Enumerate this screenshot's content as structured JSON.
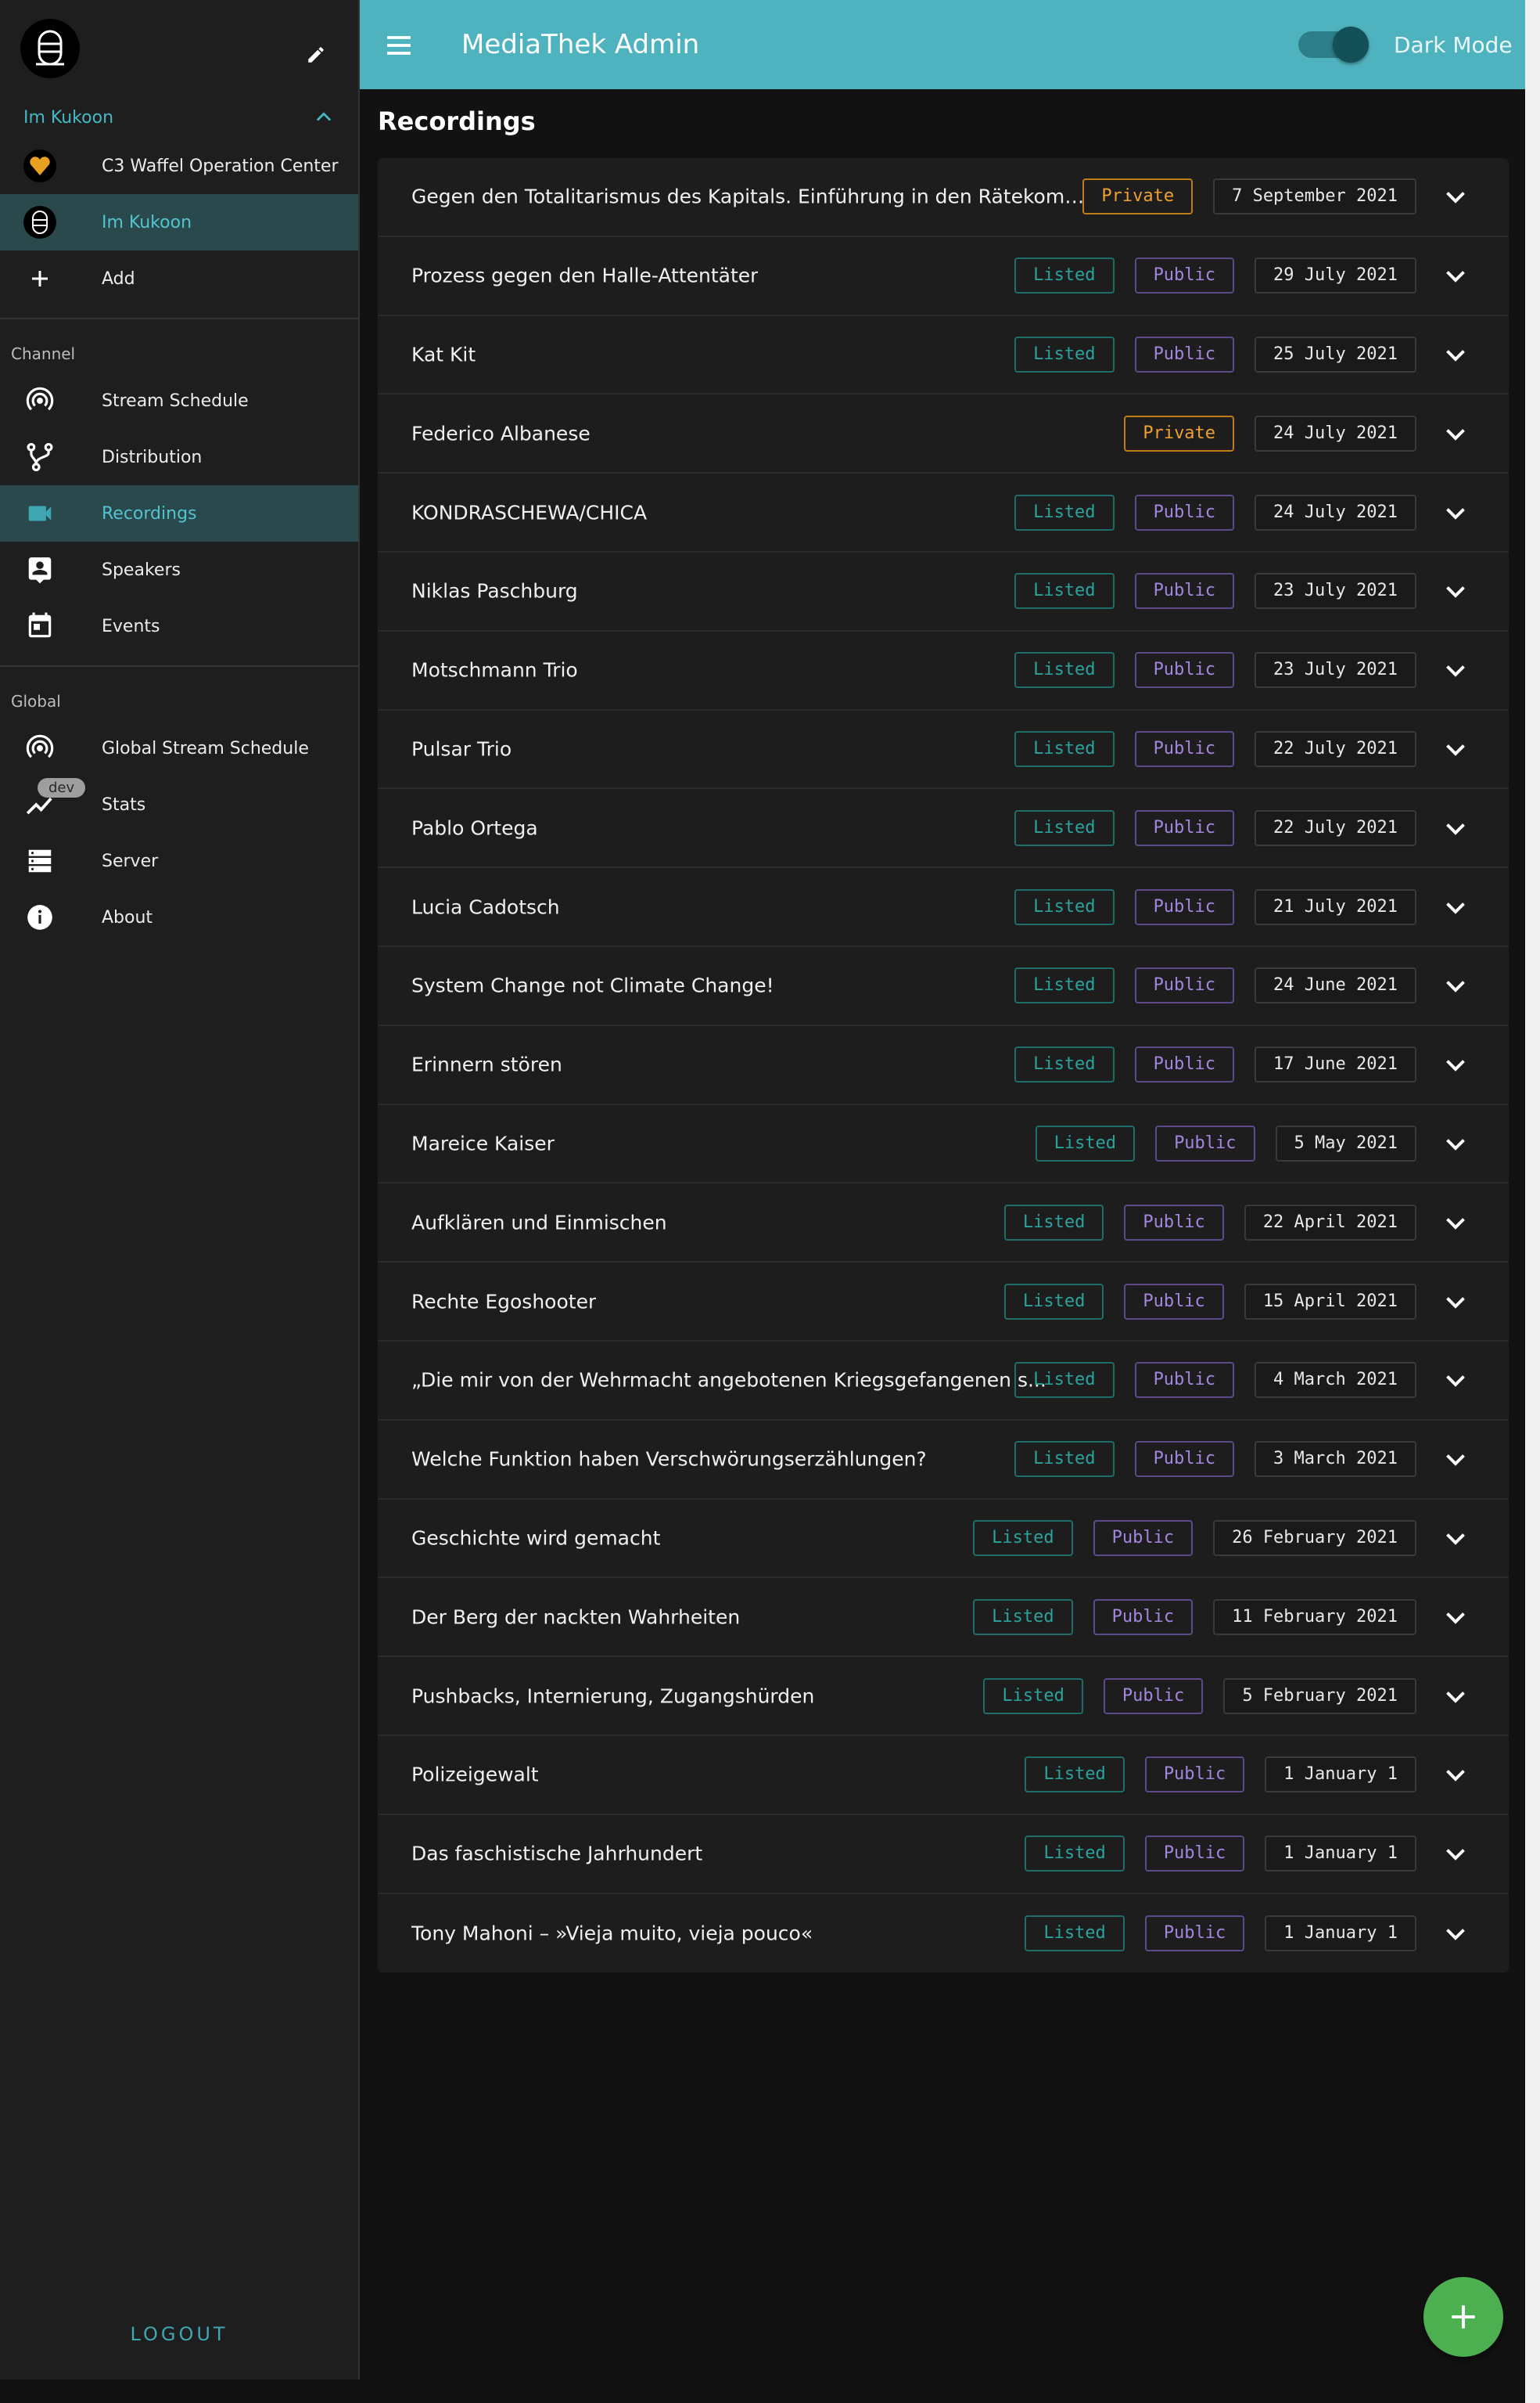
{
  "app": {
    "title": "MediaThek Admin",
    "dark_mode_label": "Dark Mode"
  },
  "sidebar": {
    "org_name": "Im Kukoon",
    "orgs": [
      {
        "label": "C3 Waffel Operation Center",
        "icon": "waffle-logo-icon"
      },
      {
        "label": "Im Kukoon",
        "icon": "kukoon-logo-icon"
      },
      {
        "label": "Add",
        "icon": "plus-icon"
      }
    ],
    "channel_label": "Channel",
    "channel_items": [
      {
        "label": "Stream Schedule",
        "icon": "broadcast-icon"
      },
      {
        "label": "Distribution",
        "icon": "fork-icon"
      },
      {
        "label": "Recordings",
        "icon": "videocam-icon"
      },
      {
        "label": "Speakers",
        "icon": "speaker-badge-icon"
      },
      {
        "label": "Events",
        "icon": "calendar-icon"
      }
    ],
    "global_label": "Global",
    "global_items": [
      {
        "label": "Global Stream Schedule",
        "icon": "broadcast-icon"
      },
      {
        "label": "Stats",
        "icon": "trending-icon",
        "badge": "dev"
      },
      {
        "label": "Server",
        "icon": "server-icon"
      },
      {
        "label": "About",
        "icon": "info-icon"
      }
    ],
    "logout": "LOGOUT"
  },
  "main": {
    "title": "Recordings",
    "recordings": [
      {
        "title": "Gegen den Totalitarismus des Kapitals. Einführung in den Rätekommu...",
        "private": "Private",
        "date": "7 September 2021"
      },
      {
        "title": "Prozess gegen den Halle-Attentäter",
        "listed": "Listed",
        "public": "Public",
        "date": "29 July 2021"
      },
      {
        "title": "Kat Kit",
        "listed": "Listed",
        "public": "Public",
        "date": "25 July 2021"
      },
      {
        "title": "Federico Albanese",
        "private": "Private",
        "date": "24 July 2021"
      },
      {
        "title": "KONDRASCHEWA/CHICA",
        "listed": "Listed",
        "public": "Public",
        "date": "24 July 2021"
      },
      {
        "title": "Niklas Paschburg",
        "listed": "Listed",
        "public": "Public",
        "date": "23 July 2021"
      },
      {
        "title": "Motschmann Trio",
        "listed": "Listed",
        "public": "Public",
        "date": "23 July 2021"
      },
      {
        "title": "Pulsar Trio",
        "listed": "Listed",
        "public": "Public",
        "date": "22 July 2021"
      },
      {
        "title": "Pablo Ortega",
        "listed": "Listed",
        "public": "Public",
        "date": "22 July 2021"
      },
      {
        "title": "Lucia Cadotsch",
        "listed": "Listed",
        "public": "Public",
        "date": "21 July 2021"
      },
      {
        "title": "System Change not Climate Change!",
        "listed": "Listed",
        "public": "Public",
        "date": "24 June 2021"
      },
      {
        "title": "Erinnern stören",
        "listed": "Listed",
        "public": "Public",
        "date": "17 June 2021"
      },
      {
        "title": "Mareice Kaiser",
        "listed": "Listed",
        "public": "Public",
        "date": "5 May 2021"
      },
      {
        "title": "Aufklären und Einmischen",
        "listed": "Listed",
        "public": "Public",
        "date": "22 April 2021"
      },
      {
        "title": "Rechte Egoshooter",
        "listed": "Listed",
        "public": "Public",
        "date": "15 April 2021"
      },
      {
        "title": "„Die mir von der Wehrmacht angebotenen Kriegsgefangenen s...",
        "listed": "Listed",
        "public": "Public",
        "date": "4 March 2021"
      },
      {
        "title": "Welche Funktion haben Verschwörungserzählungen?",
        "listed": "Listed",
        "public": "Public",
        "date": "3 March 2021"
      },
      {
        "title": "Geschichte wird gemacht",
        "listed": "Listed",
        "public": "Public",
        "date": "26 February 2021"
      },
      {
        "title": "Der Berg der nackten Wahrheiten",
        "listed": "Listed",
        "public": "Public",
        "date": "11 February 2021"
      },
      {
        "title": "Pushbacks, Internierung, Zugangshürden",
        "listed": "Listed",
        "public": "Public",
        "date": "5 February 2021"
      },
      {
        "title": "Polizeigewalt",
        "listed": "Listed",
        "public": "Public",
        "date": "1 January 1"
      },
      {
        "title": "Das faschistische Jahrhundert",
        "listed": "Listed",
        "public": "Public",
        "date": "1 January 1"
      },
      {
        "title": "Tony Mahoni – »Vieja muito, vieja pouco«",
        "listed": "Listed",
        "public": "Public",
        "date": "1 January 1"
      }
    ]
  },
  "colors": {
    "accent": "#4fb3bf",
    "listed": "#2aa39d",
    "public": "#a486e0",
    "private": "#f0a030",
    "fab": "#4caf50"
  }
}
